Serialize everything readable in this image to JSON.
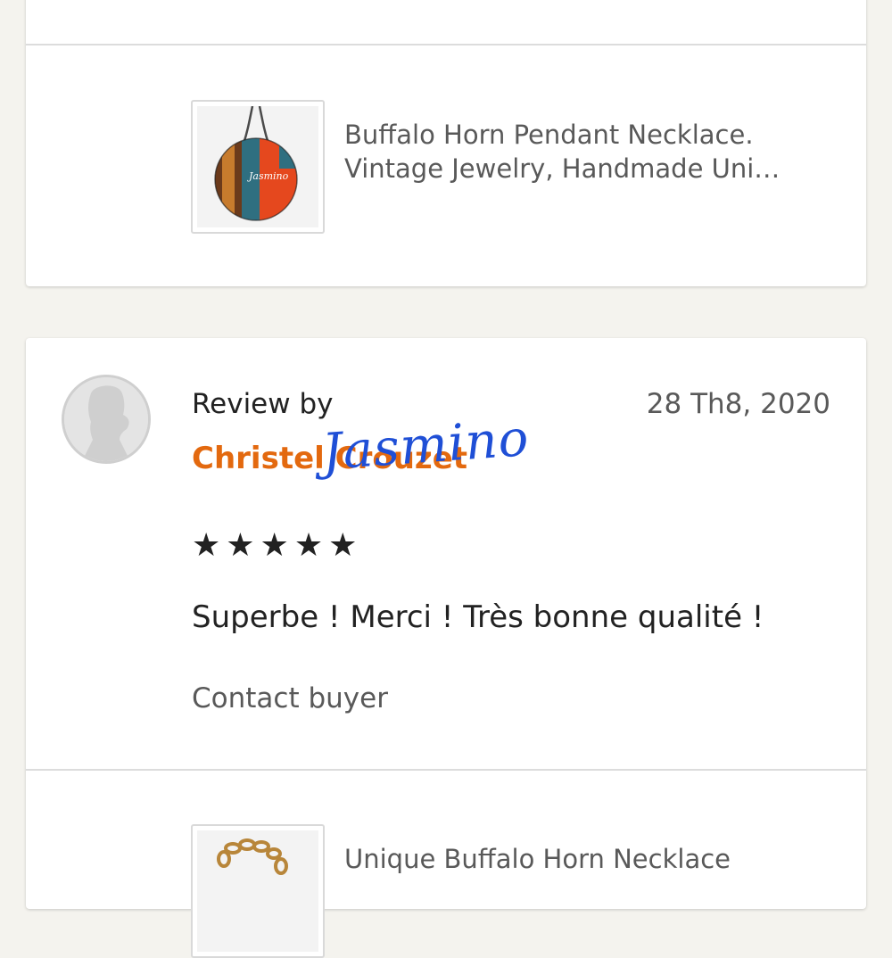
{
  "listings": [
    {
      "title_line1": "Buffalo Horn Pendant Necklace.",
      "title_line2": "Vintage Jewelry, Handmade Uni…",
      "thumb_text": "Jasmino",
      "thumb_icon": "round-pendant-image"
    },
    {
      "title_line1": "Unique Buffalo Horn Necklace",
      "thumb_icon": "chain-necklace-image"
    }
  ],
  "review": {
    "review_by_label": "Review by",
    "date": "28 Th8, 2020",
    "reviewer_name": "Christel Crouzet",
    "signature": "Jasmino",
    "rating": 5,
    "stars": "★★★★★",
    "text": "Superbe ! Merci !  Très bonne qualité !",
    "contact_label": "Contact buyer"
  },
  "colors": {
    "page_bg": "#f4f3ee",
    "reviewer_name": "#e3690f",
    "signature": "#1f4fd6",
    "muted_text": "#595959"
  }
}
